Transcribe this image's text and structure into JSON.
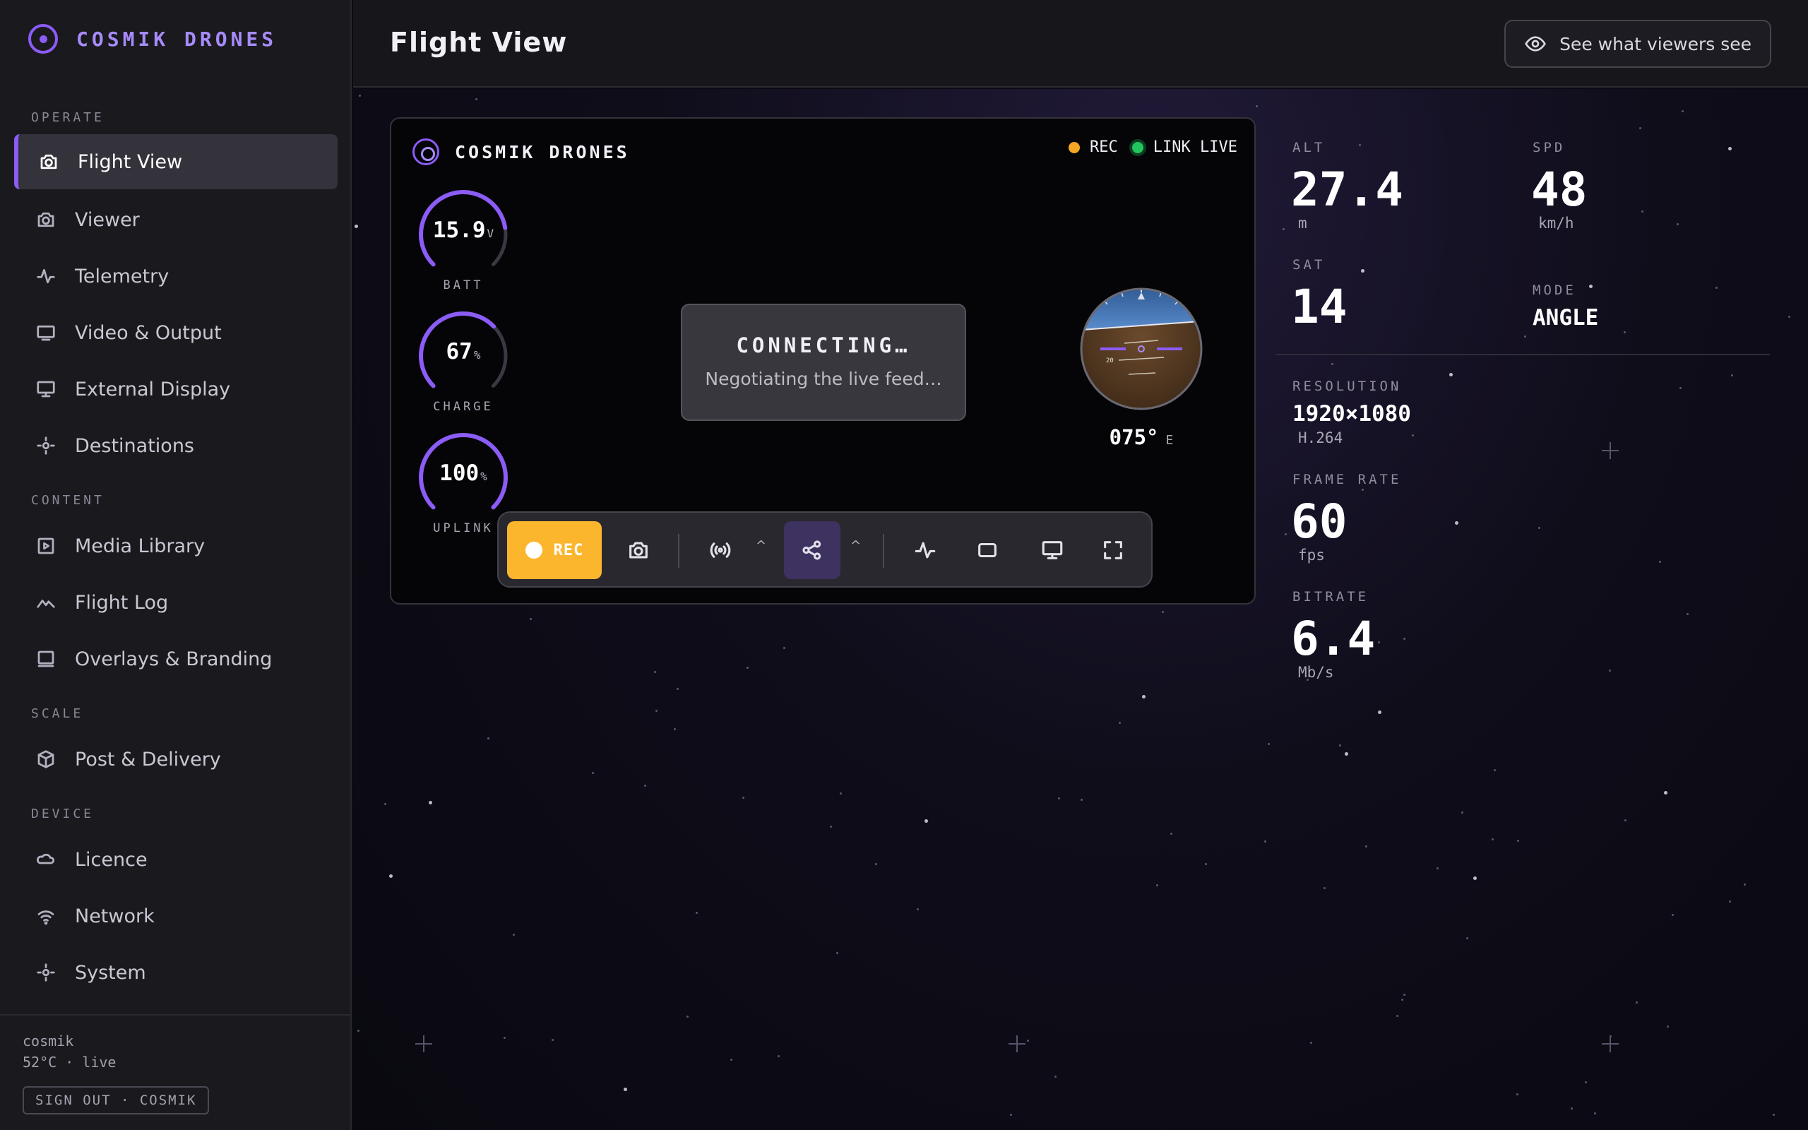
{
  "brand": {
    "name": "COSMIK DRONES"
  },
  "sidebar": {
    "sections": [
      {
        "label": "OPERATE",
        "items": [
          {
            "label": "Flight View",
            "icon": "camera-icon",
            "active": true
          },
          {
            "label": "Viewer",
            "icon": "camera-icon"
          },
          {
            "label": "Telemetry",
            "icon": "pulse-icon"
          },
          {
            "label": "Video & Output",
            "icon": "monitor-icon"
          },
          {
            "label": "External Display",
            "icon": "display-icon"
          },
          {
            "label": "Destinations",
            "icon": "target-icon"
          }
        ]
      },
      {
        "label": "CONTENT",
        "items": [
          {
            "label": "Media Library",
            "icon": "play-square-icon"
          },
          {
            "label": "Flight Log",
            "icon": "chart-line-icon"
          },
          {
            "label": "Overlays & Branding",
            "icon": "layout-icon"
          }
        ]
      },
      {
        "label": "SCALE",
        "items": [
          {
            "label": "Post & Delivery",
            "icon": "package-icon"
          }
        ]
      },
      {
        "label": "DEVICE",
        "items": [
          {
            "label": "Licence",
            "icon": "cloud-icon"
          },
          {
            "label": "Network",
            "icon": "wifi-icon"
          },
          {
            "label": "System",
            "icon": "gear-icon"
          }
        ]
      }
    ],
    "footer": {
      "user": "cosmik",
      "status": "52°C · live",
      "signout": "SIGN OUT · COSMIK"
    }
  },
  "header": {
    "title": "Flight View",
    "viewer_button": "See what viewers see"
  },
  "feed": {
    "brand": "COSMIK DRONES",
    "rec_label": "REC",
    "link_label": "LINK LIVE",
    "gauges": [
      {
        "value": "15.9",
        "unit": "V",
        "label": "BATT",
        "fraction": 0.8
      },
      {
        "value": "67",
        "unit": "%",
        "label": "CHARGE",
        "fraction": 0.67
      },
      {
        "value": "100",
        "unit": "%",
        "label": "UPLINK",
        "fraction": 1.0
      }
    ],
    "connecting": {
      "title": "CONNECTING…",
      "subtitle": "Negotiating the live feed…"
    },
    "horizon_pitch_marker": "20",
    "heading": {
      "value": "075°",
      "dir": "E"
    },
    "toolbar": {
      "rec": "REC"
    }
  },
  "telemetry": {
    "alt": {
      "label": "ALT",
      "value": "27.4",
      "unit": "m"
    },
    "spd": {
      "label": "SPD",
      "value": "48",
      "unit": "km/h"
    },
    "sat": {
      "label": "SAT",
      "value": "14"
    },
    "mode": {
      "label": "MODE",
      "value": "ANGLE"
    },
    "resolution": {
      "label": "RESOLUTION",
      "value": "1920×1080",
      "codec": "H.264"
    },
    "framerate": {
      "label": "FRAME RATE",
      "value": "60",
      "unit": "fps"
    },
    "bitrate": {
      "label": "BITRATE",
      "value": "6.4",
      "unit": "Mb/s"
    }
  },
  "colors": {
    "accent": "#8b5cf6",
    "rec": "#fbb62e",
    "live": "#22c55e"
  }
}
